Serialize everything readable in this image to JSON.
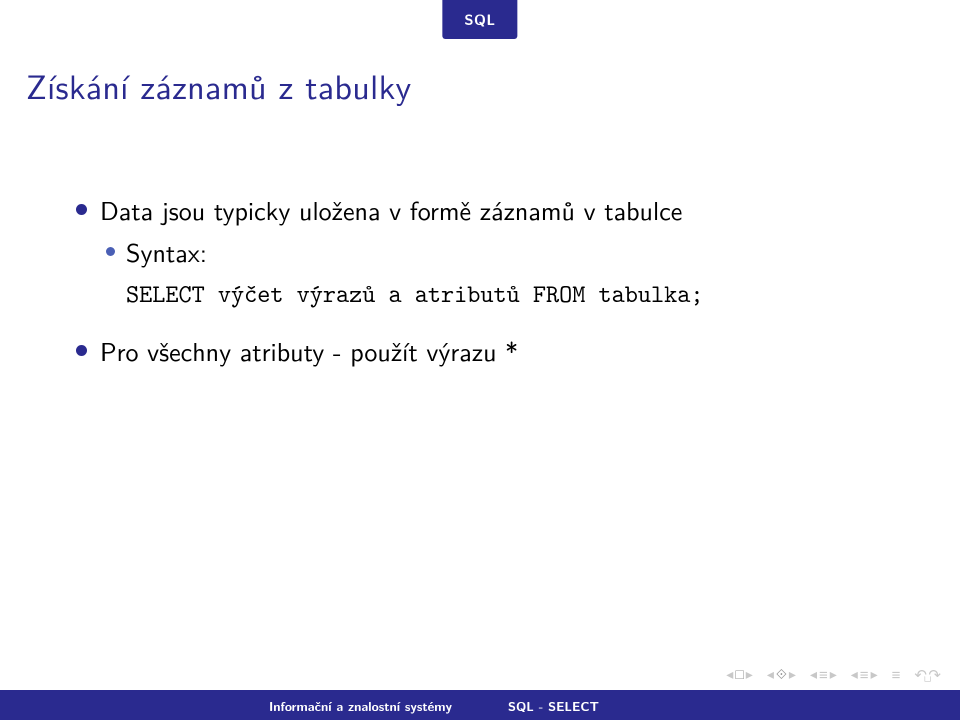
{
  "header": {
    "section_tab": "SQL"
  },
  "frametitle": "Získání záznamů z tabulky",
  "bullets": {
    "b1": "Data jsou typicky uložena v formě záznamů v tabulce",
    "b2": "Syntax:",
    "code": "SELECT výčet výrazů a atributů FROM tabulka;",
    "b3": "Pro všechny atributy - použít výrazu *"
  },
  "footer": {
    "left": "Informační a znalostní systémy",
    "right": "SQL - SELECT"
  }
}
